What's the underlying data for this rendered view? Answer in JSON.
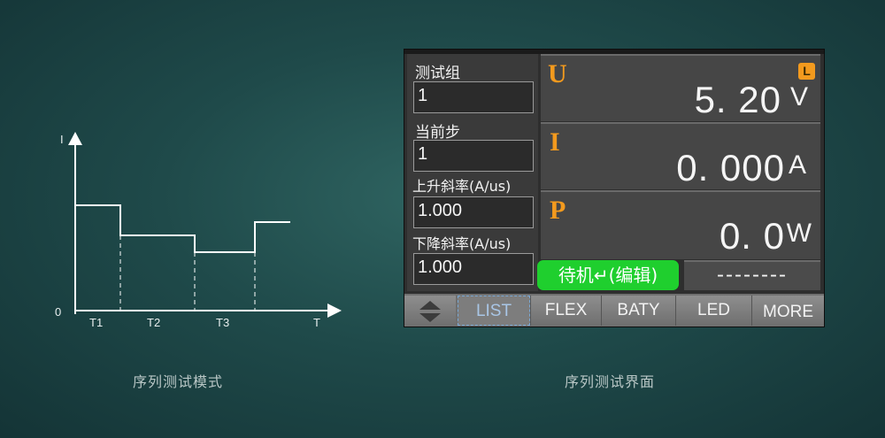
{
  "left": {
    "caption": "序列测试模式",
    "axis": {
      "y_label": "I",
      "x_label": "T",
      "origin": "0",
      "ticks": [
        "T1",
        "T2",
        "T3"
      ]
    }
  },
  "right": {
    "caption": "序列测试界面",
    "fields": [
      {
        "label": "测试组",
        "value": "1"
      },
      {
        "label": "当前步",
        "value": "1"
      },
      {
        "label": "上升斜率(A/us)",
        "value": "1.000"
      },
      {
        "label": "下降斜率(A/us)",
        "value": "1.000"
      }
    ],
    "meters": [
      {
        "letter": "U",
        "value": "5. 20",
        "unit": "V",
        "badge": "L"
      },
      {
        "letter": "I",
        "value": "0. 000",
        "unit": "A"
      },
      {
        "letter": "P",
        "value": "0. 0",
        "unit": "W"
      }
    ],
    "status_button": "待机↵(编辑)",
    "status_value": "--------",
    "tabs": [
      "LIST",
      "FLEX",
      "BATY",
      "LED",
      "MORE"
    ],
    "active_tab": "LIST"
  }
}
